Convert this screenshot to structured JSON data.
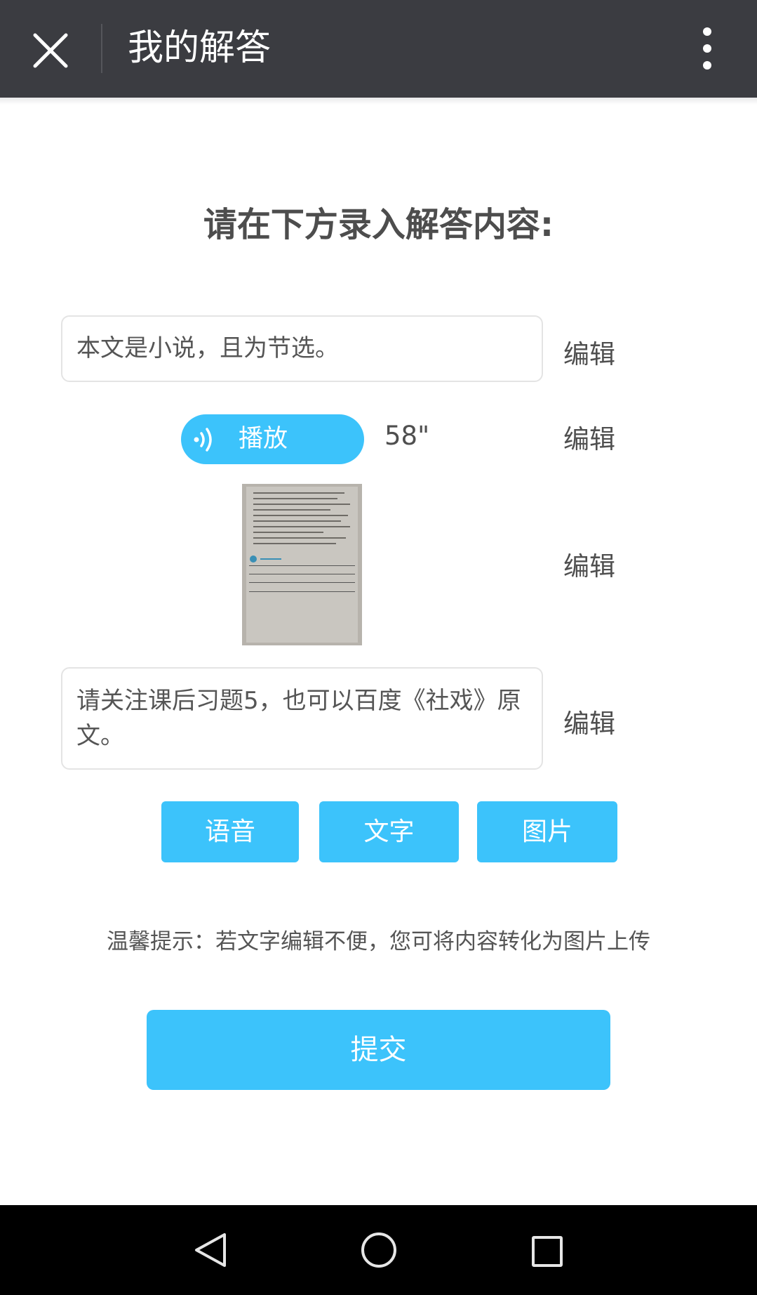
{
  "header": {
    "title": "我的解答"
  },
  "main": {
    "heading": "请在下方录入解答内容:",
    "answers": [
      {
        "type": "text",
        "content": "本文是小说，且为节选。",
        "edit_label": "编辑"
      },
      {
        "type": "audio",
        "play_label": "播放",
        "duration": "58\"",
        "edit_label": "编辑"
      },
      {
        "type": "image",
        "edit_label": "编辑"
      },
      {
        "type": "text",
        "content": "请关注课后习题5，也可以百度《社戏》原文。",
        "edit_label": "编辑"
      }
    ],
    "add_buttons": {
      "voice": "语音",
      "text": "文字",
      "image": "图片"
    },
    "tip": "温馨提示：若文字编辑不便，您可将内容转化为图片上传",
    "submit_label": "提交"
  },
  "colors": {
    "accent": "#3cc3fb",
    "topbar": "#3b3c41",
    "navbar": "#000000"
  },
  "icons": [
    "close-icon",
    "more-icon",
    "audio-wave-icon",
    "nav-back-icon",
    "nav-home-icon",
    "nav-recents-icon"
  ]
}
